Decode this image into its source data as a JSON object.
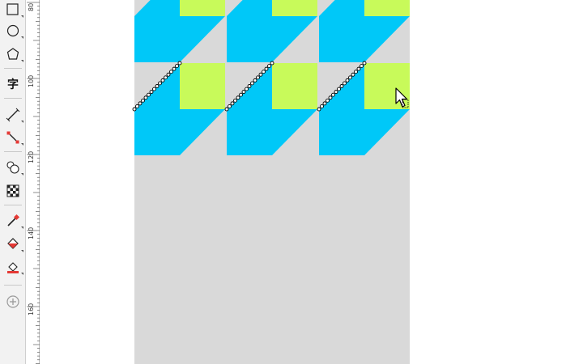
{
  "toolbox": {
    "tools": [
      {
        "name": "rectangle-tool",
        "icon": "rectangle-icon"
      },
      {
        "name": "ellipse-tool",
        "icon": "ellipse-icon"
      },
      {
        "name": "polygon-tool",
        "icon": "polygon-icon"
      },
      {
        "name": "text-tool",
        "icon": "text-icon",
        "glyph": "字"
      },
      {
        "name": "parallel-dimension-tool",
        "icon": "dimension-line-icon"
      },
      {
        "name": "connector-tool",
        "icon": "connector-icon"
      },
      {
        "name": "blend-tool",
        "icon": "blend-icon"
      },
      {
        "name": "transparency-tool",
        "icon": "transparency-icon"
      },
      {
        "name": "eyedropper-tool",
        "icon": "eyedropper-icon"
      },
      {
        "name": "interactive-fill-tool",
        "icon": "fill-bucket-icon"
      },
      {
        "name": "smart-fill-tool",
        "icon": "smart-fill-icon"
      },
      {
        "name": "add-tool",
        "icon": "plus-circle-icon"
      }
    ]
  },
  "ruler": {
    "labels": [
      "80",
      "100",
      "120",
      "140",
      "160"
    ]
  },
  "colors": {
    "page": "#d9d9d9",
    "cyan": "#00c8f8",
    "lime": "#c8fa5a",
    "workspace": "#ffffff"
  }
}
